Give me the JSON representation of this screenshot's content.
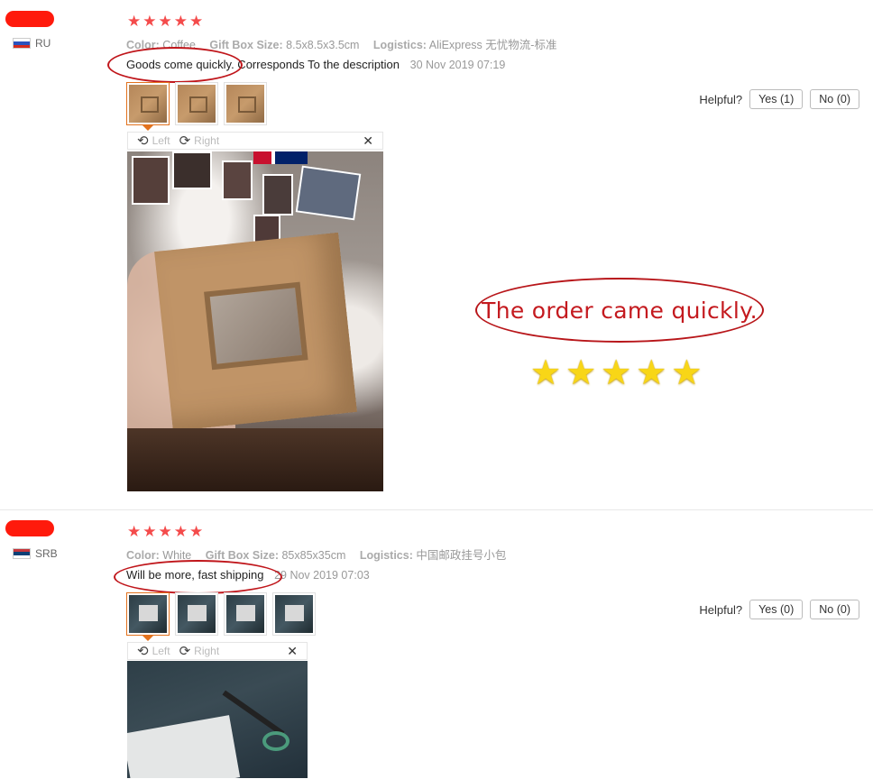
{
  "reviews": [
    {
      "country": "RU",
      "attributes": [
        {
          "label": "Color:",
          "value": "Coffee"
        },
        {
          "label": "Gift Box Size:",
          "value": "8.5x8.5x3.5cm"
        },
        {
          "label": "Logistics:",
          "value": "AliExpress 无忧物流-标准"
        }
      ],
      "feedback": "Goods come quickly. Corresponds To the description",
      "date": "30 Nov 2019 07:19",
      "rating": 5,
      "helpful": {
        "label": "Helpful?",
        "yes": "Yes (1)",
        "no": "No (0)"
      },
      "toolbar": {
        "left": "Left",
        "right": "Right"
      }
    },
    {
      "country": "SRB",
      "attributes": [
        {
          "label": "Color:",
          "value": "White"
        },
        {
          "label": "Gift Box Size:",
          "value": "85x85x35cm"
        },
        {
          "label": "Logistics:",
          "value": "中国邮政挂号小包"
        }
      ],
      "feedback": "Will be more, fast shipping",
      "date": "29 Nov 2019 07:03",
      "rating": 5,
      "helpful": {
        "label": "Helpful?",
        "yes": "Yes (0)",
        "no": "No (0)"
      },
      "toolbar": {
        "left": "Left",
        "right": "Right"
      }
    }
  ],
  "annotation": {
    "text": "The order came quickly.",
    "stars": 5
  },
  "icons": {
    "star": "star-icon",
    "rotate_left": "rotate-left-icon",
    "rotate_right": "rotate-right-icon",
    "close": "close-icon"
  },
  "colors": {
    "star_red": "#f44b4b",
    "annotation_red": "#c41a1f",
    "gold_star": "#f8d617",
    "redaction": "#ff1a0c",
    "active_thumb": "#e2721e"
  }
}
